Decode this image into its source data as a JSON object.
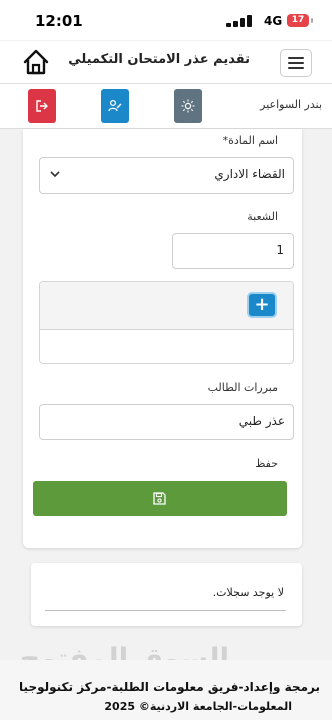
{
  "status_bar": {
    "time": "12:01",
    "network": "4G",
    "battery": "17"
  },
  "header": {
    "title": "تقديم عذر الامتحان التكميلي",
    "home_icon": "home-icon",
    "menu_icon": "hamburger-icon"
  },
  "toolbar": {
    "user_name": "بندر السواعير",
    "buttons": [
      "logout-icon",
      "user-edit-icon",
      "sun-icon"
    ],
    "colors": {
      "logout": "#dc3545",
      "user": "#1a88c9",
      "theme": "#5f7380"
    }
  },
  "form": {
    "subject_label": "اسم المادة*",
    "subject_value": "القضاء الاداري",
    "section_label": "الشعبة",
    "section_value": "1",
    "add_symbol": "+",
    "justification_label": "مبررات الطالب",
    "justification_value": "عذر طبي",
    "save_label": "حفظ",
    "save_color": "#5c9a3c"
  },
  "records": {
    "empty_text": "لا يوجد سجلات."
  },
  "footer": {
    "line1": "برمجة وإعداد-فريق معلومات الطلبة-مركز تكنولوجيا",
    "line2": "المعلومات-الجامعة الاردنية© 2025"
  },
  "watermark": "السوق المفتوح"
}
